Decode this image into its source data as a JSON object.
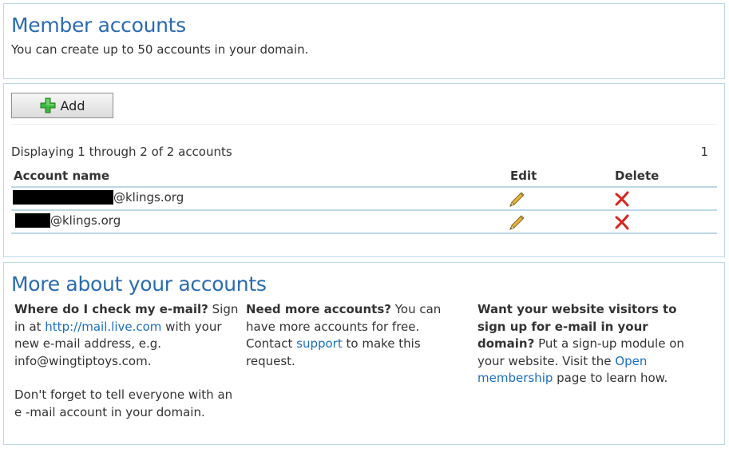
{
  "header": {
    "title": "Member accounts",
    "subtitle": "You can create up to 50 accounts in your domain."
  },
  "toolbar": {
    "add_label": "Add"
  },
  "listing": {
    "display_count": "Displaying 1 through 2 of 2 accounts",
    "page_number": "1",
    "columns": {
      "account": "Account name",
      "edit": "Edit",
      "delete": "Delete"
    },
    "rows": [
      {
        "domain_suffix": "@klings.org"
      },
      {
        "domain_suffix": "@klings.org"
      }
    ]
  },
  "more": {
    "title": "More about your accounts",
    "col1": {
      "q": "Where do I check my e-mail?",
      "t1": " Sign in at ",
      "link": "http://mail.live.com",
      "t2": " with your new e-mail address, e.g. info@wingtiptoys.com.",
      "p2": "Don't forget to tell everyone with an e -mail account in your domain."
    },
    "col2": {
      "q": "Need more accounts?",
      "t1": " You can have more accounts for free. Contact ",
      "link": "support",
      "t2": " to make this request."
    },
    "col3": {
      "q": "Want your website visitors to sign up for e-mail in your domain?",
      "t1": " Put a sign-up module on your website. Visit the ",
      "link": "Open membership",
      "t2": " page to learn how."
    }
  },
  "colors": {
    "title_blue": "#2a6bb0",
    "link_blue": "#1a6fc1",
    "border_blue": "#bcd8e6",
    "delete_red": "#d7261e",
    "add_green": "#3cb83c"
  },
  "icons": {
    "add": "plus-icon",
    "edit": "pencil-icon",
    "delete": "red-x-icon"
  }
}
